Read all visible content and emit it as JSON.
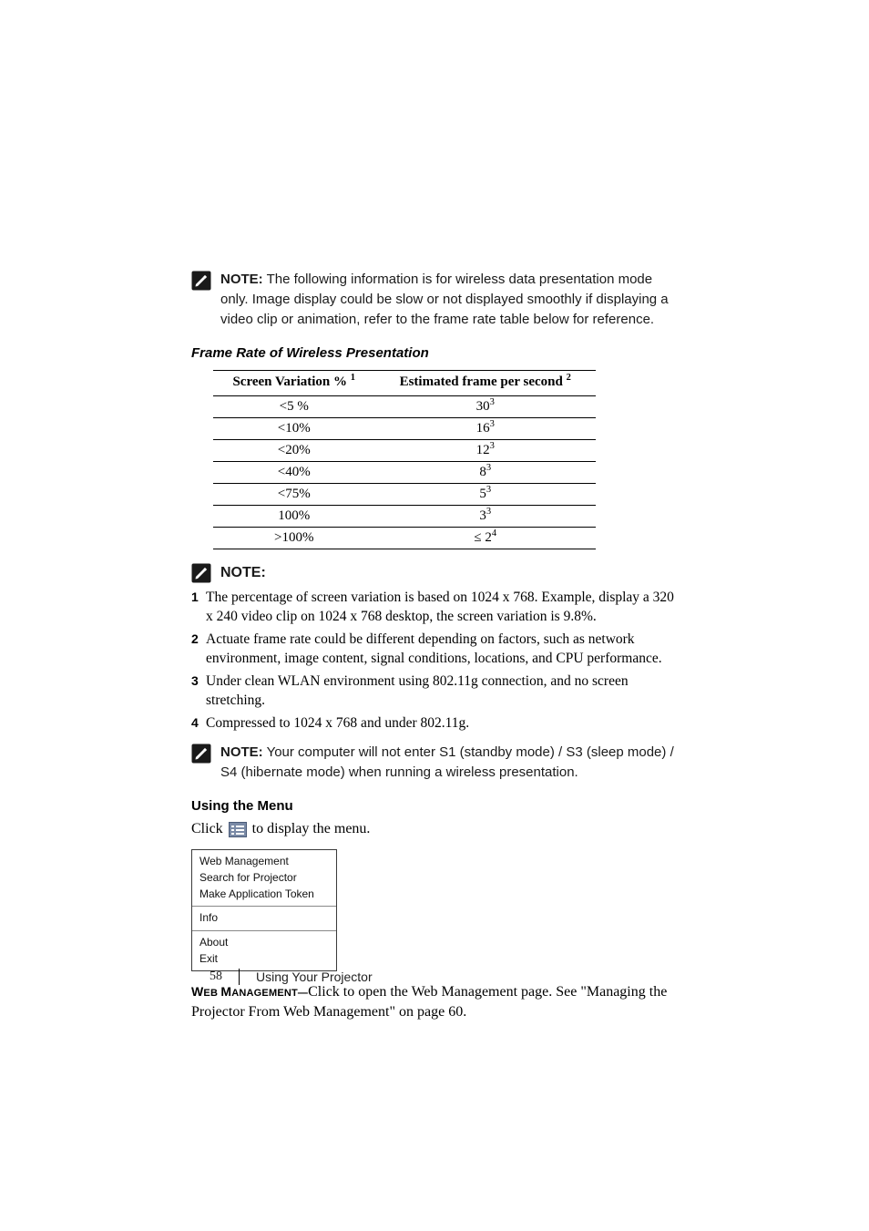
{
  "note1": {
    "label": "NOTE:",
    "text": " The following information is for wireless data presentation mode only. Image display could be slow or not displayed smoothly if displaying a video clip or animation, refer to the frame rate table below for reference."
  },
  "table_title": "Frame Rate of Wireless Presentation",
  "table": {
    "head": {
      "col1_label": "Screen Variation % ",
      "col1_sup": "1",
      "col2_label": "Estimated frame per second ",
      "col2_sup": "2"
    },
    "rows": [
      {
        "c1": "<5 %",
        "c2": "30",
        "c2_sup": "3"
      },
      {
        "c1": "<10%",
        "c2": "16",
        "c2_sup": "3"
      },
      {
        "c1": "<20%",
        "c2": "12",
        "c2_sup": "3"
      },
      {
        "c1": "<40%",
        "c2": "8",
        "c2_sup": "3"
      },
      {
        "c1": "<75%",
        "c2": "5",
        "c2_sup": "3"
      },
      {
        "c1": "100%",
        "c2": "3",
        "c2_sup": "3"
      },
      {
        "c1": ">100%",
        "c2": "≤ 2",
        "c2_sup": "4"
      }
    ]
  },
  "note2_label": "NOTE:",
  "footnotes": [
    {
      "n": "1",
      "t": "The percentage of screen variation is based on 1024 x 768.  Example, display a 320 x 240 video clip on 1024 x 768 desktop, the screen variation is 9.8%."
    },
    {
      "n": "2",
      "t": "Actuate frame rate could be different depending on factors, such as network environment, image content, signal conditions, locations, and CPU performance."
    },
    {
      "n": "3",
      "t": "Under clean WLAN environment using 802.11g connection, and no screen stretching."
    },
    {
      "n": "4",
      "t": "Compressed to 1024 x 768 and under 802.11g."
    }
  ],
  "note3": {
    "label": "NOTE:",
    "text": " Your computer will not enter S1 (standby mode) / S3 (sleep mode) / S4 (hibernate mode) when running a wireless presentation."
  },
  "using_menu_heading": "Using the Menu",
  "click_line_before": "Click ",
  "click_line_after": " to display the menu.",
  "menu": {
    "group1": [
      "Web Management",
      "Search for Projector",
      "Make Application Token"
    ],
    "group2": [
      "Info"
    ],
    "group3": [
      "About",
      "Exit"
    ]
  },
  "webmgmt": {
    "caps_major": "W",
    "caps_minor1": "EB ",
    "caps_major2": "M",
    "caps_minor2": "ANAGEMENT—",
    "rest": "Click to open the Web Management page. See \"Managing the Projector From Web Management\" on page 60."
  },
  "footer": {
    "page": "58",
    "section": "Using Your Projector"
  },
  "chart_data": {
    "type": "table",
    "title": "Frame Rate of Wireless Presentation",
    "columns": [
      "Screen Variation % (1)",
      "Estimated frame per second (2)"
    ],
    "rows": [
      [
        "<5 %",
        "30 (3)"
      ],
      [
        "<10%",
        "16 (3)"
      ],
      [
        "<20%",
        "12 (3)"
      ],
      [
        "<40%",
        "8 (3)"
      ],
      [
        "<75%",
        "5 (3)"
      ],
      [
        "100%",
        "3 (3)"
      ],
      [
        ">100%",
        "≤ 2 (4)"
      ]
    ],
    "footnotes": {
      "1": "The percentage of screen variation is based on 1024 x 768. Example, display a 320 x 240 video clip on 1024 x 768 desktop, the screen variation is 9.8%.",
      "2": "Actuate frame rate could be different depending on factors, such as network environment, image content, signal conditions, locations, and CPU performance.",
      "3": "Under clean WLAN environment using 802.11g connection, and no screen stretching.",
      "4": "Compressed to 1024 x 768 and under 802.11g."
    }
  }
}
